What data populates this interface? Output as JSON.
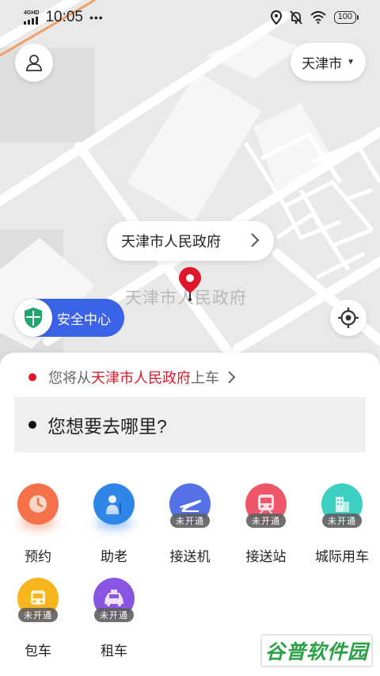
{
  "status_bar": {
    "network": "4GHD",
    "time": "10:05",
    "more": "•••",
    "battery": "100"
  },
  "map": {
    "place_label": "天津市人民政府"
  },
  "header": {
    "city": "天津市"
  },
  "location_bubble": {
    "text": "天津市人民政府"
  },
  "safety": {
    "label": "安全中心"
  },
  "pickup": {
    "prefix": "您将从",
    "place": "天津市人民政府",
    "suffix": "上车"
  },
  "destination": {
    "placeholder": "您想要去哪里?"
  },
  "services": [
    {
      "label": "预约",
      "icon": "clock-icon",
      "color": "#f4714a",
      "badge": ""
    },
    {
      "label": "助老",
      "icon": "elder-icon",
      "color": "#2e86e8",
      "badge": ""
    },
    {
      "label": "接送机",
      "icon": "airplane-icon",
      "color": "#5471e6",
      "badge": "未开通"
    },
    {
      "label": "接送站",
      "icon": "train-icon",
      "color": "#f0566a",
      "badge": "未开通"
    },
    {
      "label": "城际用车",
      "icon": "building-icon",
      "color": "#3bd0c2",
      "badge": "未开通"
    },
    {
      "label": "包车",
      "icon": "bus-icon",
      "color": "#f7b51e",
      "badge": "未开通"
    },
    {
      "label": "租车",
      "icon": "taxi-icon",
      "color": "#8b55e4",
      "badge": "未开通"
    }
  ],
  "watermark": "谷普软件园"
}
